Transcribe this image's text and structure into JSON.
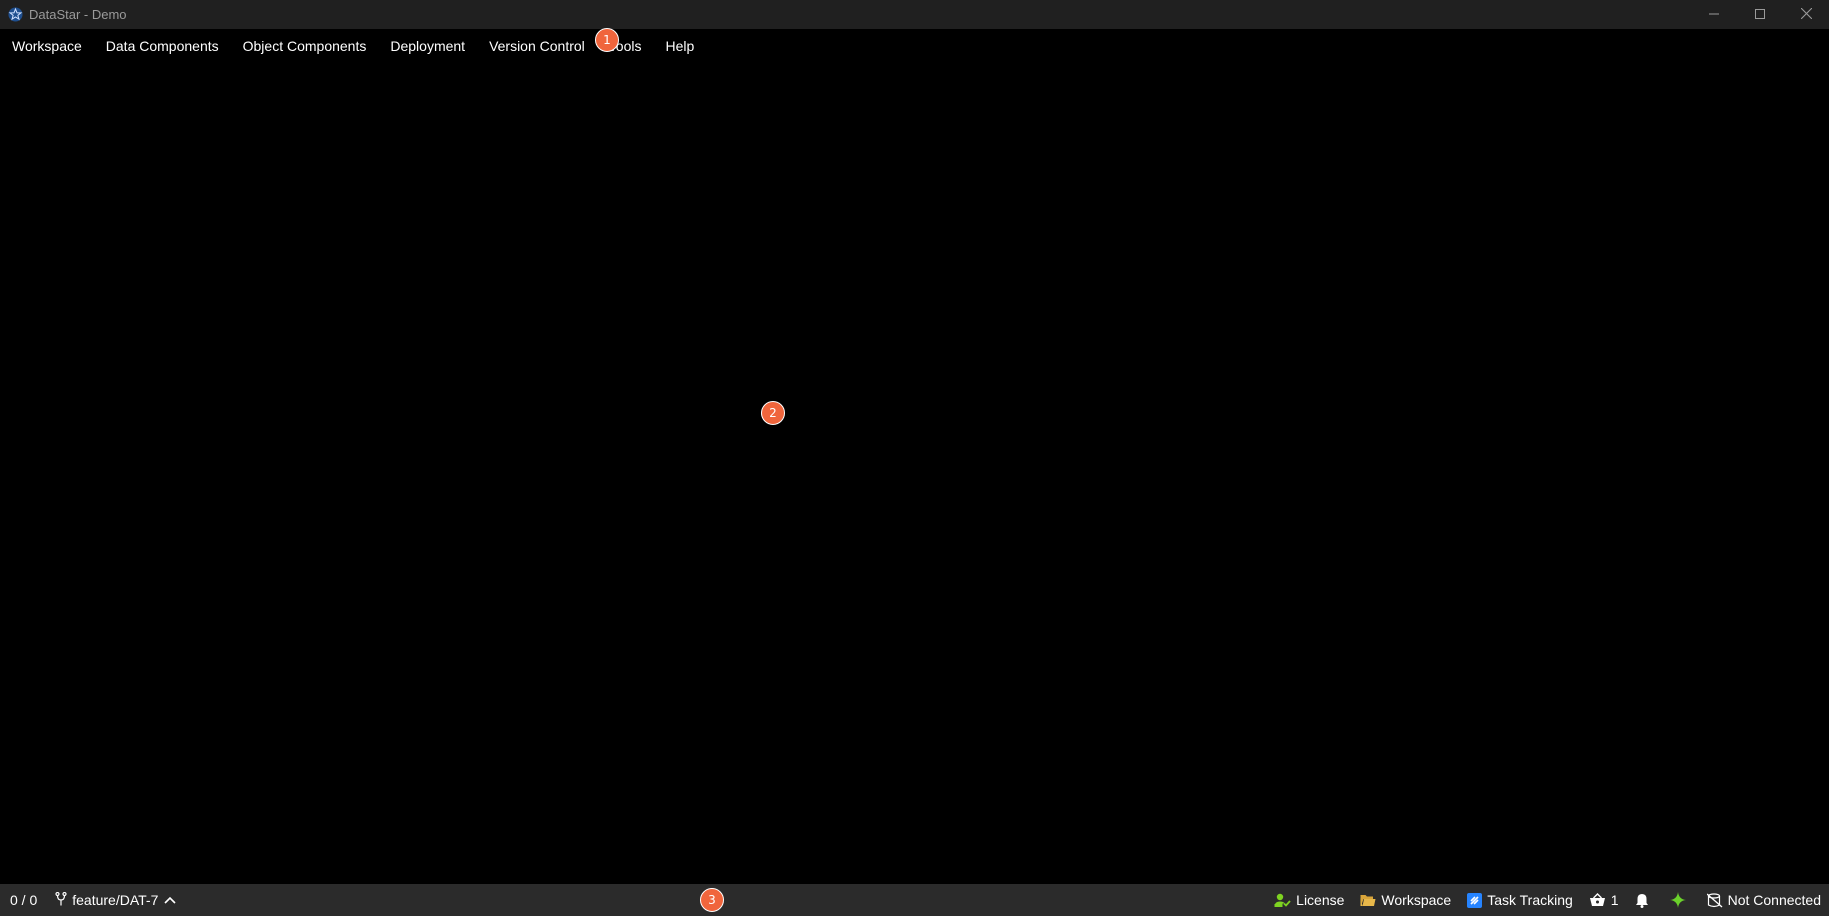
{
  "window": {
    "title": "DataStar - Demo",
    "icons": {
      "app": "datastar-star-icon",
      "minimize": "minimize-icon",
      "maximize": "maximize-icon",
      "close": "close-icon"
    }
  },
  "menubar": {
    "items": [
      {
        "label": "Workspace"
      },
      {
        "label": "Data Components"
      },
      {
        "label": "Object Components"
      },
      {
        "label": "Deployment"
      },
      {
        "label": "Version Control"
      },
      {
        "label": "Tools"
      },
      {
        "label": "Help"
      }
    ]
  },
  "annotations": {
    "badge_1": "1",
    "badge_2": "2",
    "badge_3": "3"
  },
  "statusbar": {
    "count": "0 / 0",
    "branch": "feature/DAT-7",
    "license": "License",
    "workspace": "Workspace",
    "task_tracking": "Task Tracking",
    "basket_count": "1",
    "connection": "Not Connected"
  },
  "colors": {
    "titlebar_bg": "#202020",
    "statusbar_bg": "#2b2b2b",
    "badge": "#f0653c",
    "license_green": "#7ed321",
    "folder_yellow": "#e8b84a",
    "jira_blue": "#2684ff",
    "sparkle_green": "#6bd12b"
  }
}
